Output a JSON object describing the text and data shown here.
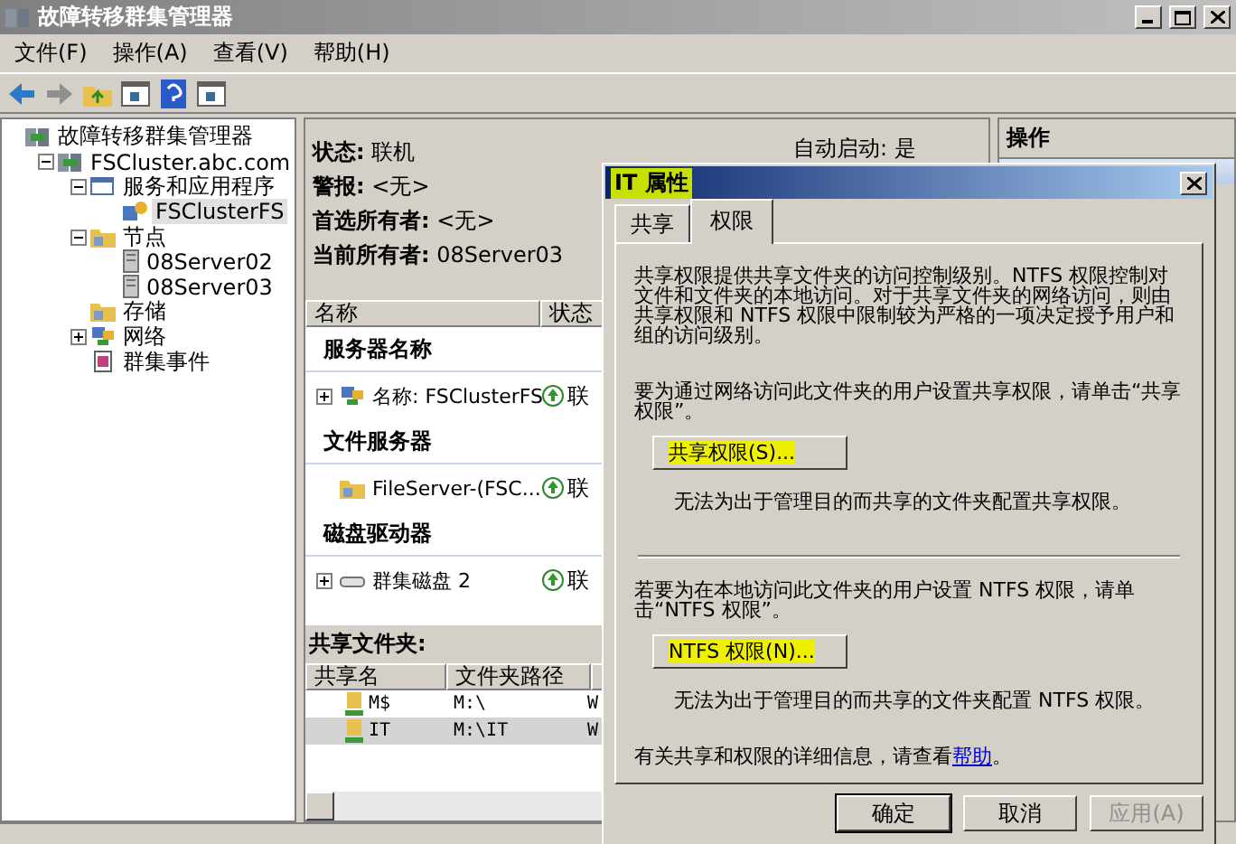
{
  "window": {
    "title": "故障转移群集管理器"
  },
  "menu": [
    "文件(F)",
    "操作(A)",
    "查看(V)",
    "帮助(H)"
  ],
  "toolbar": [
    {
      "kind": "back"
    },
    {
      "kind": "forward"
    },
    {
      "kind": "up"
    },
    {
      "kind": "panel"
    },
    {
      "kind": "help"
    },
    {
      "kind": "panel"
    }
  ],
  "tree": [
    {
      "label": "故障转移群集管理器",
      "kind": "manager",
      "selected": false,
      "children": [
        {
          "label": "FSCluster.abc.com",
          "kind": "cluster",
          "expanded": true,
          "selected": false,
          "children": [
            {
              "label": "服务和应用程序",
              "kind": "services",
              "expanded": true,
              "selected": false,
              "children": [
                {
                  "label": "FSClusterFS",
                  "kind": "service",
                  "selected": true
                }
              ]
            },
            {
              "label": "节点",
              "kind": "nodes",
              "expanded": true,
              "selected": false,
              "children": [
                {
                  "label": "08Server02",
                  "kind": "server",
                  "selected": false
                },
                {
                  "label": "08Server03",
                  "kind": "server",
                  "selected": false
                }
              ]
            },
            {
              "label": "存储",
              "kind": "storage",
              "selected": false
            },
            {
              "label": "网络",
              "kind": "network",
              "expanded": false,
              "selected": false
            },
            {
              "label": "群集事件",
              "kind": "events",
              "selected": false
            }
          ]
        }
      ]
    }
  ],
  "summary": {
    "auto_start": "自动启动: 是",
    "lines": [
      {
        "label": "状态:",
        "value": "联机"
      },
      {
        "label": "警报:",
        "value": "<无>"
      },
      {
        "label": "首选所有者:",
        "value": "<无>"
      },
      {
        "label": "当前所有者:",
        "value": "08Server03"
      }
    ]
  },
  "resources": {
    "columns": [
      "名称",
      "状态"
    ],
    "groups": [
      {
        "title": "服务器名称",
        "items": [
          {
            "name": "名称: FSClusterFS",
            "status": "联",
            "kind": "network-name",
            "expanded": false
          }
        ]
      },
      {
        "title": "文件服务器",
        "items": [
          {
            "name": "FileServer-(FSC...",
            "status": "联",
            "kind": "file-server"
          }
        ]
      },
      {
        "title": "磁盘驱动器",
        "items": [
          {
            "name": "群集磁盘 2",
            "status": "联",
            "kind": "disk",
            "expanded": false
          }
        ]
      }
    ]
  },
  "shares": {
    "title": "共享文件夹:",
    "columns": [
      "共享名",
      "文件夹路径"
    ],
    "rows": [
      {
        "name": "M$",
        "path": "M:\\",
        "column_3": "W",
        "selected": false
      },
      {
        "name": "IT",
        "path": "M:\\IT",
        "column_3": "W",
        "selected": true
      }
    ]
  },
  "actions_pane": {
    "title": "操作"
  },
  "dialog": {
    "title": "IT 属性",
    "title_highlighted": true,
    "tabs": [
      {
        "label": "共享",
        "selected": false
      },
      {
        "label": "权限",
        "selected": true
      }
    ],
    "intro": "共享权限提供共享文件夹的访问控制级别。NTFS 权限控制对文件和文件夹的本地访问。对于共享文件夹的网络访问，则由共享权限和 NTFS 权限中限制较为严格的一项决定授予用户和组的访问级别。",
    "sections": [
      {
        "instruction": "要为通过网络访问此文件夹的用户设置共享权限，请单击“共享权限”。",
        "button": "共享权限(S)...",
        "highlighted": true,
        "note": "无法为出于管理目的而共享的文件夹配置共享权限。"
      },
      {
        "instruction": "若要为在本地访问此文件夹的用户设置 NTFS 权限，请单击“NTFS 权限”。",
        "button": "NTFS 权限(N)...",
        "highlighted": true,
        "note": "无法为出于管理目的而共享的文件夹配置 NTFS 权限。"
      }
    ],
    "help_text": "有关共享和权限的详细信息，请查看",
    "help_link": "帮助",
    "help_end": "。",
    "buttons": [
      {
        "label": "确定",
        "disabled": false,
        "default": true
      },
      {
        "label": "取消",
        "disabled": false,
        "default": false
      },
      {
        "label": "应用(A)",
        "disabled": true,
        "default": false
      }
    ]
  }
}
